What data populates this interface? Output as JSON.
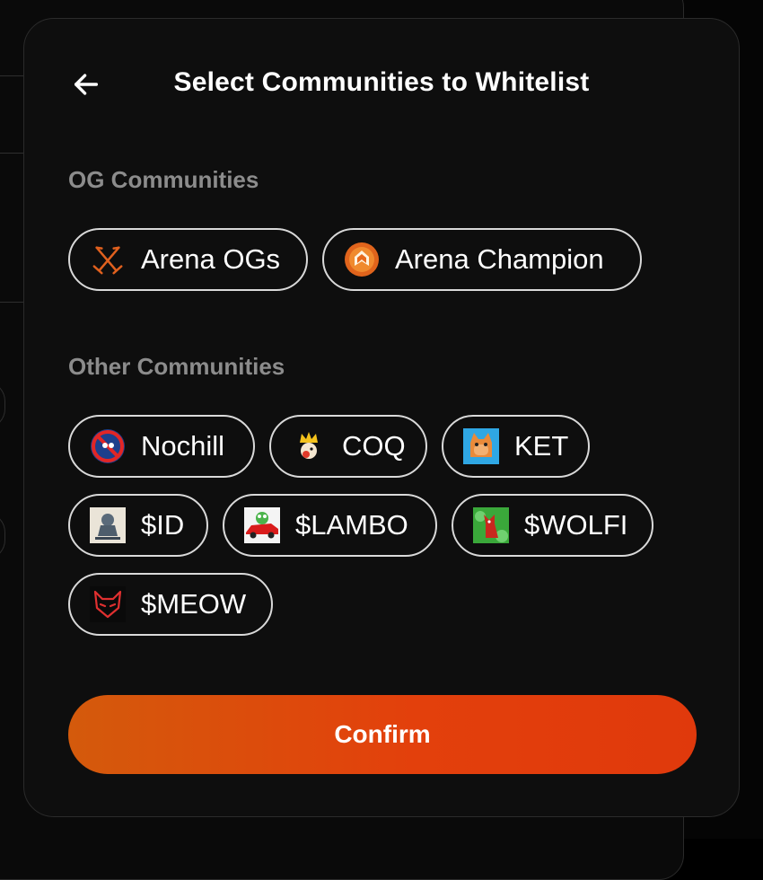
{
  "modal": {
    "title": "Select Communities to Whitelist",
    "back_icon": "arrow-left-icon"
  },
  "sections": {
    "og": {
      "label": "OG Communities",
      "items": [
        {
          "label": "Arena OGs",
          "icon": "crossed-swords-icon"
        },
        {
          "label": "Arena Champion",
          "icon": "orange-badge-icon"
        }
      ]
    },
    "other": {
      "label": "Other Communities",
      "items": [
        {
          "label": "Nochill",
          "icon": "nochill-avatar"
        },
        {
          "label": "COQ",
          "icon": "crown-chicken-avatar"
        },
        {
          "label": "KET",
          "icon": "cat-avatar"
        },
        {
          "label": "$ID",
          "icon": "integrity-avatar"
        },
        {
          "label": "$LAMBO",
          "icon": "frog-car-avatar"
        },
        {
          "label": "$WOLFI",
          "icon": "wolf-avatar"
        },
        {
          "label": "$MEOW",
          "icon": "devil-cat-avatar"
        }
      ]
    }
  },
  "confirm_label": "Confirm",
  "colors": {
    "accent_start": "#d45a0c",
    "accent_end": "#e0390c",
    "modal_bg": "#0e0e0e",
    "section_label": "#8c8c8c"
  }
}
